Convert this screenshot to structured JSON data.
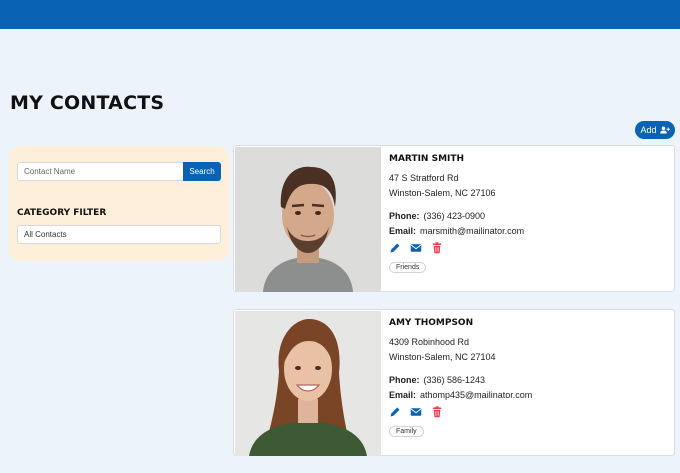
{
  "page": {
    "title": "MY CONTACTS"
  },
  "toolbar": {
    "add_label": "Add",
    "add_icon": "user-plus-icon"
  },
  "filter": {
    "search_placeholder": "Contact Name",
    "search_label": "Search",
    "category_title": "CATEGORY FILTER",
    "category_value": "All Contacts"
  },
  "colors": {
    "accent": "#0a62b5",
    "panel": "#fdefd9",
    "background": "#ecf3fb",
    "delete": "#e8424d"
  },
  "contacts": [
    {
      "name": "MARTIN SMITH",
      "address1": "47 S Stratford Rd",
      "address2": "Winston-Salem, NC 27106",
      "phone_label": "Phone:",
      "phone": "(336) 423-0900",
      "email_label": "Email:",
      "email": "marsmith@mailinator.com",
      "tag": "Friends"
    },
    {
      "name": "AMY THOMPSON",
      "address1": "4309 Robinhood Rd",
      "address2": "Winston-Salem, NC 27104",
      "phone_label": "Phone:",
      "phone": "(336) 586-1243",
      "email_label": "Email:",
      "email": "athomp435@mailinator.com",
      "tag": "Family"
    }
  ]
}
